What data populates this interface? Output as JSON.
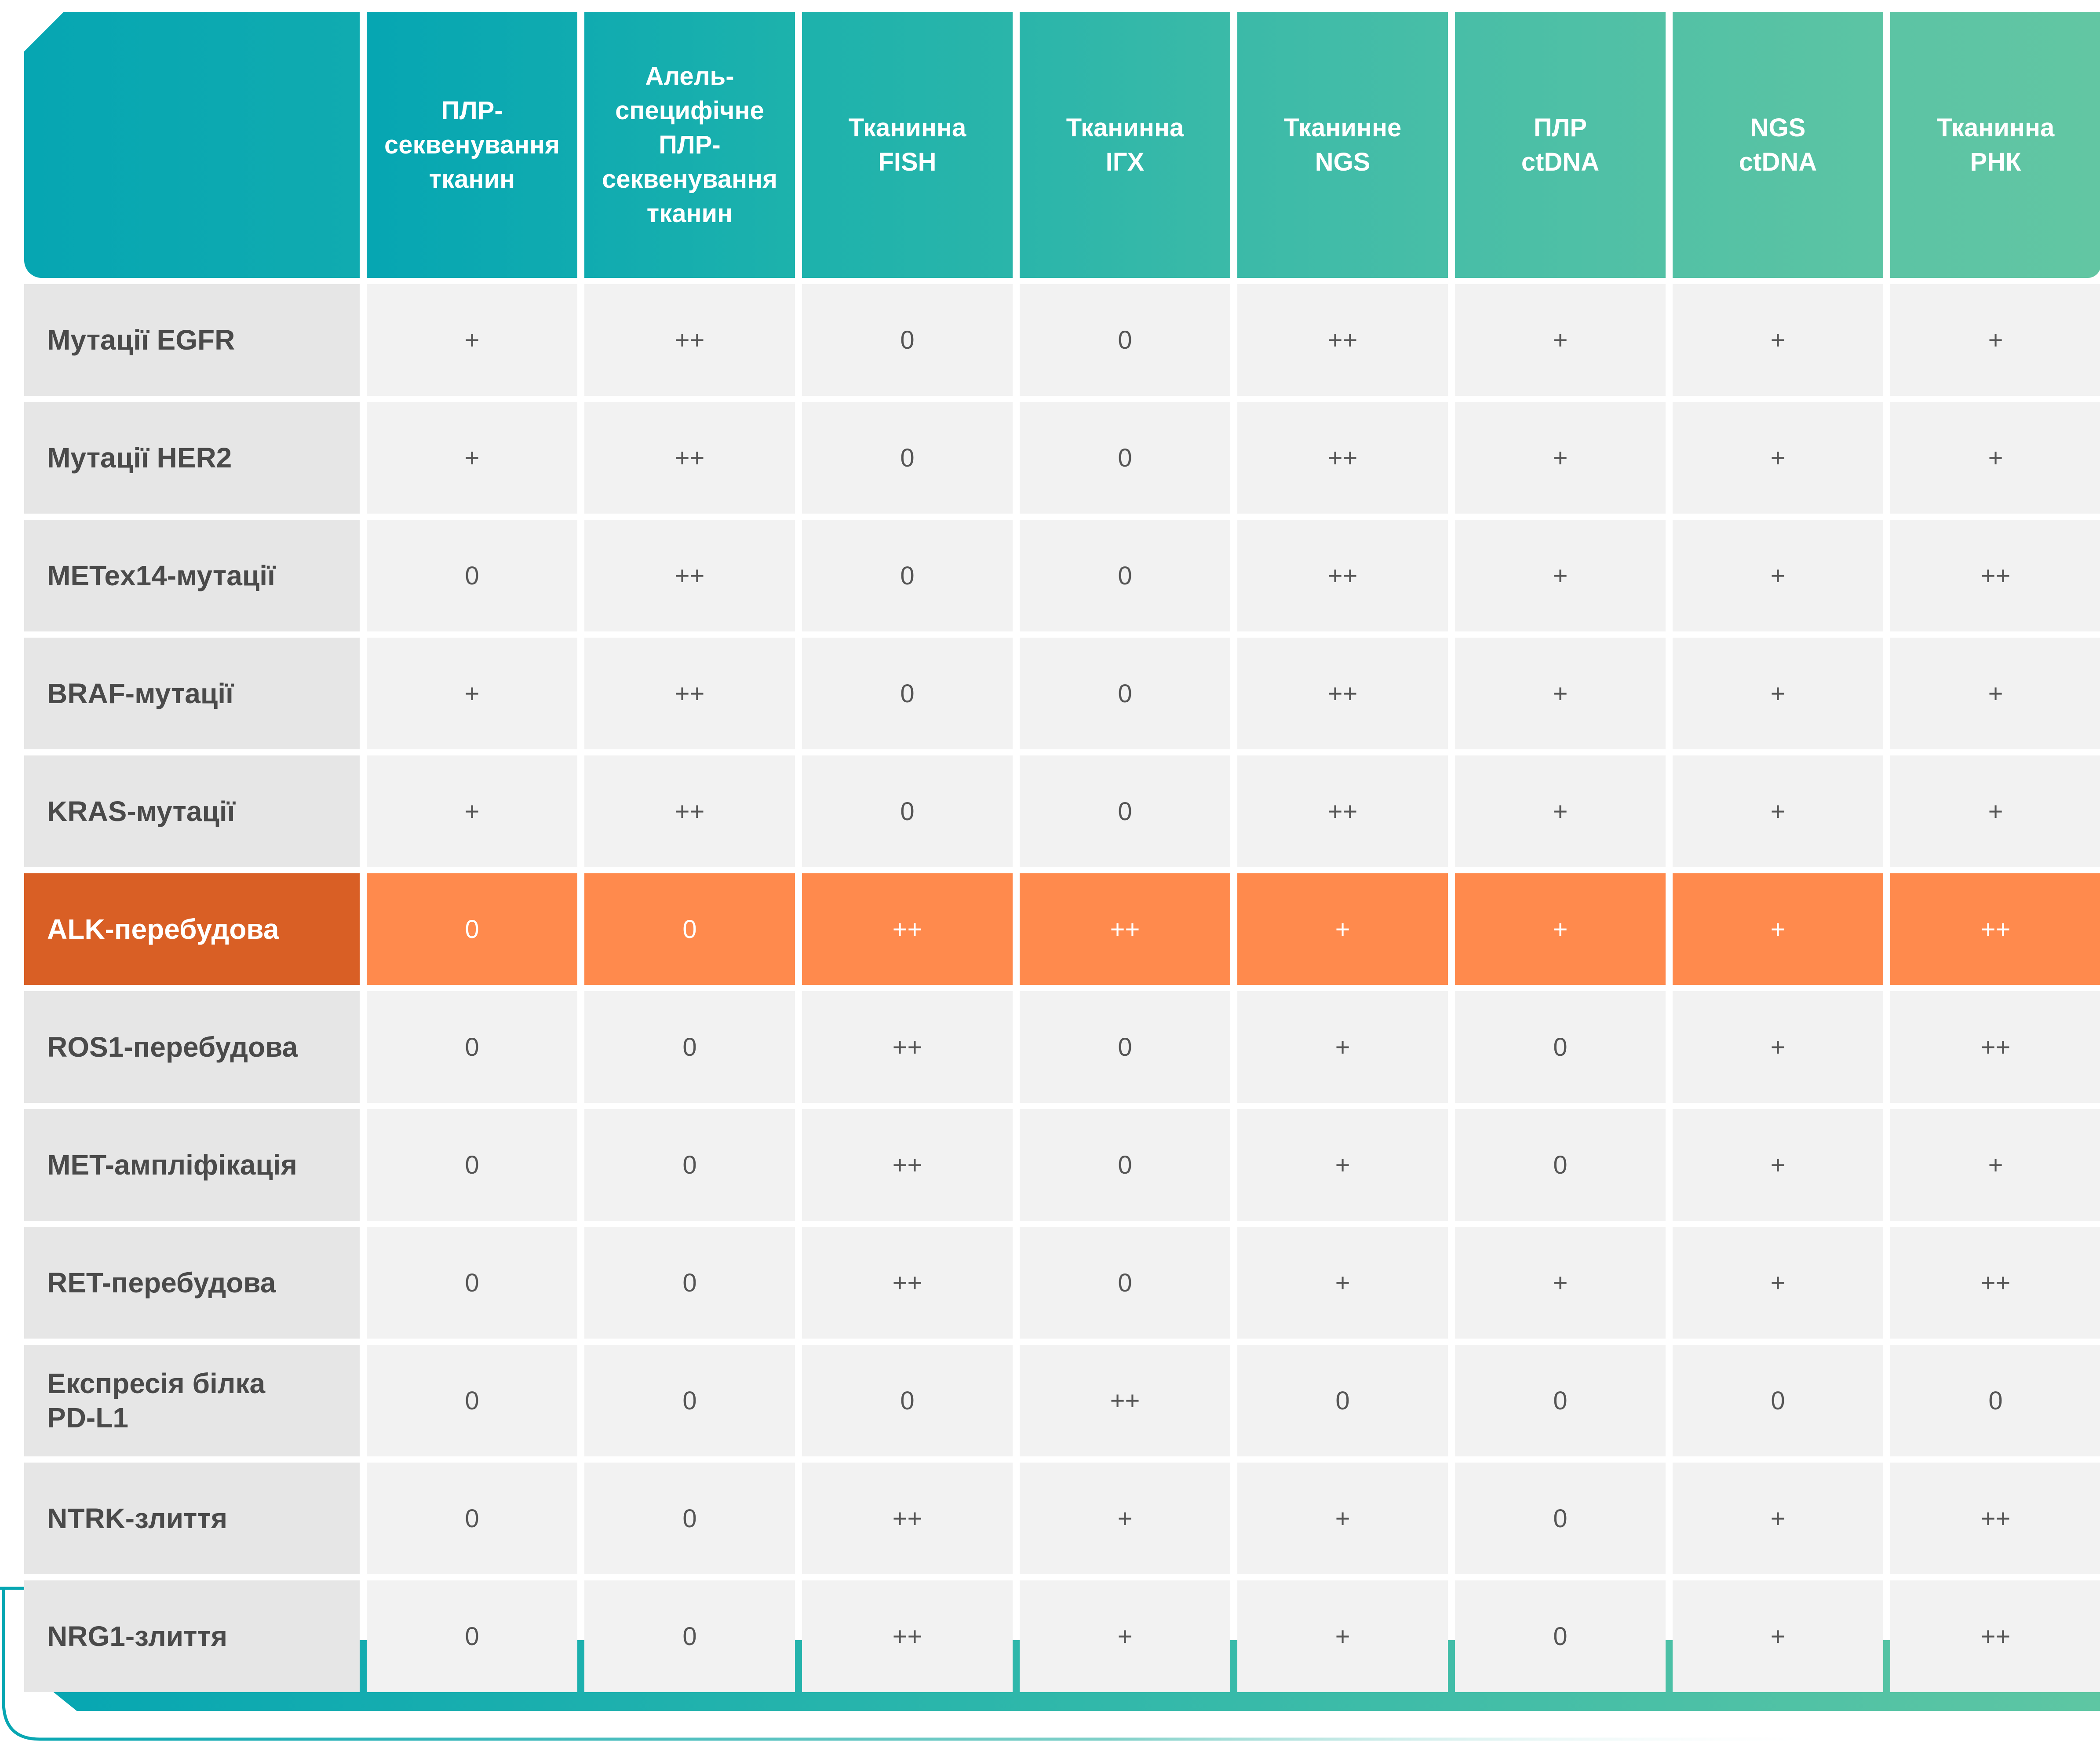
{
  "table": {
    "columns": [
      "ПЛР-\nсеквенування\nтканин",
      "Алель-\nспецифічне\nПЛР-\nсеквенування\nтканин",
      "Тканинна\nFISH",
      "Тканинна\nІГХ",
      "Тканинне\nNGS",
      "ПЛР\nctDNA",
      "NGS\nctDNA",
      "Тканинна\nРНК"
    ],
    "rows": [
      {
        "label": "Мутації EGFR",
        "values": [
          "+",
          "++",
          "0",
          "0",
          "++",
          "+",
          "+",
          "+"
        ]
      },
      {
        "label": "Мутації HER2",
        "values": [
          "+",
          "++",
          "0",
          "0",
          "++",
          "+",
          "+",
          "+"
        ]
      },
      {
        "label": "METex14-мутації",
        "values": [
          "0",
          "++",
          "0",
          "0",
          "++",
          "+",
          "+",
          "++"
        ]
      },
      {
        "label": "BRAF-мутації",
        "values": [
          "+",
          "++",
          "0",
          "0",
          "++",
          "+",
          "+",
          "+"
        ]
      },
      {
        "label": "KRAS-мутації",
        "values": [
          "+",
          "++",
          "0",
          "0",
          "++",
          "+",
          "+",
          "+"
        ]
      },
      {
        "label": "ALK-перебудова",
        "values": [
          "0",
          "0",
          "++",
          "++",
          "+",
          "+",
          "+",
          "++"
        ],
        "highlighted": true
      },
      {
        "label": "ROS1-перебудова",
        "values": [
          "0",
          "0",
          "++",
          "0",
          "+",
          "0",
          "+",
          "++"
        ]
      },
      {
        "label": "MET-ампліфікація",
        "values": [
          "0",
          "0",
          "++",
          "0",
          "+",
          "0",
          "+",
          "+"
        ]
      },
      {
        "label": "RET-перебудова",
        "values": [
          "0",
          "0",
          "++",
          "0",
          "+",
          "+",
          "+",
          "++"
        ]
      },
      {
        "label": "Експресія білка\nPD-L1",
        "values": [
          "0",
          "0",
          "0",
          "++",
          "0",
          "0",
          "0",
          "0"
        ]
      },
      {
        "label": "NTRK-злиття",
        "values": [
          "0",
          "0",
          "++",
          "+",
          "+",
          "0",
          "+",
          "++"
        ]
      },
      {
        "label": "NRG1-злиття",
        "values": [
          "0",
          "0",
          "++",
          "+",
          "+",
          "0",
          "+",
          "++"
        ]
      }
    ]
  },
  "colors": {
    "header_gradient": [
      "#06a6b2",
      "#10abb0",
      "#1db2ac",
      "#2ab5aa",
      "#3bbaa8",
      "#48bea7",
      "#53c1a5",
      "#5cc4a4",
      "#62c6a3"
    ],
    "highlight_label": "#d95f25",
    "highlight_cell": "#ff8a4d",
    "label_bg": "#e6e6e6",
    "cell_bg": "#f2f2f2"
  }
}
